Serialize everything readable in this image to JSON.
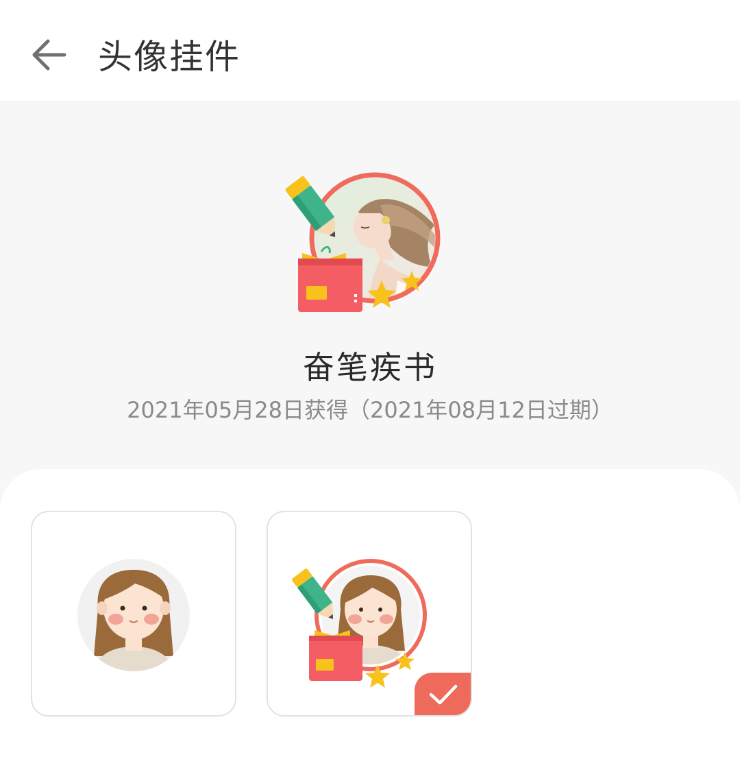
{
  "header": {
    "title": "头像挂件",
    "back_icon": "arrow-left-icon"
  },
  "current_pendant": {
    "name": "奋笔疾书",
    "date_info": "2021年05月28日获得（2021年08月12日过期）"
  },
  "pendant_options": [
    {
      "id": "none",
      "icon": "default-avatar",
      "selected": false
    },
    {
      "id": "fenbi-jishu",
      "icon": "pencil-book-pendant-avatar",
      "selected": true
    }
  ],
  "colors": {
    "accent": "#ee6a5a",
    "ring": "#ef6b5b",
    "book": "#f35d63",
    "pencil": "#3fb48a",
    "star": "#f8c21c"
  }
}
